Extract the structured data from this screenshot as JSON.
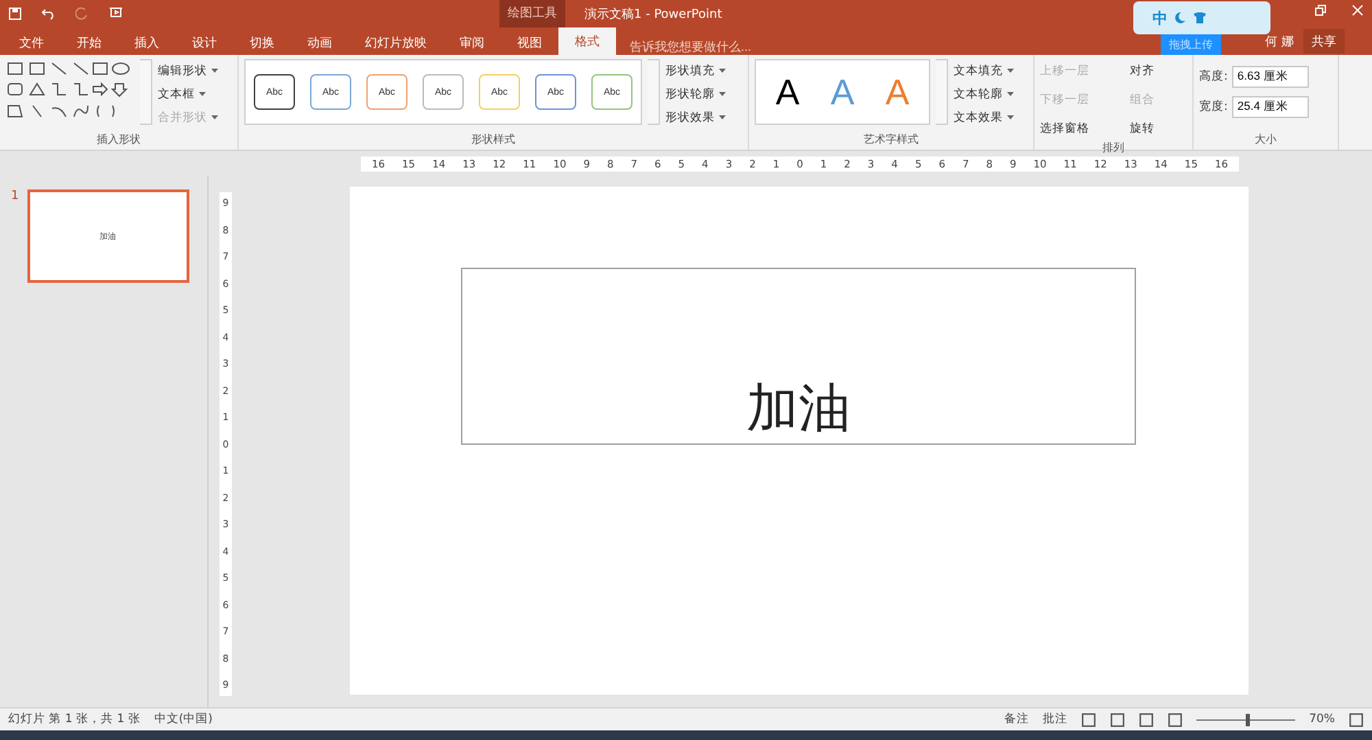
{
  "title_bar": {
    "context_tab": "绘图工具",
    "title": "演示文稿1 - PowerPoint",
    "user": "何 娜",
    "share": "共享"
  },
  "ime_bar": {
    "mode": "中",
    "upload": "拖拽上传"
  },
  "tabs": [
    {
      "label": "文件",
      "selected": false
    },
    {
      "label": "开始",
      "selected": false
    },
    {
      "label": "插入",
      "selected": false
    },
    {
      "label": "设计",
      "selected": false
    },
    {
      "label": "切换",
      "selected": false
    },
    {
      "label": "动画",
      "selected": false
    },
    {
      "label": "幻灯片放映",
      "selected": false
    },
    {
      "label": "审阅",
      "selected": false
    },
    {
      "label": "视图",
      "selected": false
    },
    {
      "label": "格式",
      "selected": true
    }
  ],
  "tell_me": {
    "placeholder": "告诉我您想要做什么..."
  },
  "ribbon": {
    "insert_shapes": {
      "label": "插入形状",
      "commands": [
        {
          "label": "编辑形状",
          "disabled": false
        },
        {
          "label": "文本框",
          "disabled": false
        },
        {
          "label": "合并形状",
          "disabled": true
        }
      ]
    },
    "shape_styles": {
      "label": "形状样式",
      "swatches": [
        {
          "text": "Abc",
          "color": "#404040"
        },
        {
          "text": "Abc",
          "color": "#7aa7d8"
        },
        {
          "text": "Abc",
          "color": "#f0a070"
        },
        {
          "text": "Abc",
          "color": "#bbbbbb"
        },
        {
          "text": "Abc",
          "color": "#f5d060"
        },
        {
          "text": "Abc",
          "color": "#6f94d8"
        },
        {
          "text": "Abc",
          "color": "#94c47a"
        }
      ],
      "commands": [
        "形状填充",
        "形状轮廓",
        "形状效果"
      ]
    },
    "wordart": {
      "label": "艺术字样式",
      "letters": [
        {
          "text": "A",
          "color": "#000000"
        },
        {
          "text": "A",
          "color": "#5b9bd5"
        },
        {
          "text": "A",
          "color": "#ed7d31"
        }
      ],
      "commands": [
        "文本填充",
        "文本轮廓",
        "文本效果"
      ]
    },
    "arrange": {
      "label": "排列",
      "commands": [
        {
          "label": "上移一层",
          "disabled": true
        },
        {
          "label": "对齐",
          "disabled": false
        },
        {
          "label": "下移一层",
          "disabled": true
        },
        {
          "label": "组合",
          "disabled": true
        },
        {
          "label": "选择窗格",
          "disabled": false
        },
        {
          "label": "旋转",
          "disabled": false
        }
      ]
    },
    "size": {
      "label": "大小",
      "fields": [
        {
          "label": "高度:",
          "value": "6.63 厘米"
        },
        {
          "label": "宽度:",
          "value": "25.4 厘米"
        }
      ]
    }
  },
  "ruler": {
    "horizontal": [
      "16",
      "15",
      "14",
      "13",
      "12",
      "11",
      "10",
      "9",
      "8",
      "7",
      "6",
      "5",
      "4",
      "3",
      "2",
      "1",
      "0",
      "1",
      "2",
      "3",
      "4",
      "5",
      "6",
      "7",
      "8",
      "9",
      "10",
      "11",
      "12",
      "13",
      "14",
      "15",
      "16"
    ],
    "vertical": [
      "9",
      "8",
      "7",
      "6",
      "5",
      "4",
      "3",
      "2",
      "1",
      "0",
      "1",
      "2",
      "3",
      "4",
      "5",
      "6",
      "7",
      "8",
      "9"
    ]
  },
  "thumbnails": [
    {
      "number": "1",
      "text": "加油",
      "selected": true
    }
  ],
  "slide": {
    "text": "加油"
  },
  "status_bar": {
    "slide_info": "幻灯片 第 1 张，共 1 张",
    "language": "中文(中国)",
    "notes": "备注",
    "comments": "批注",
    "zoom": "70%",
    "level": 0.5
  }
}
